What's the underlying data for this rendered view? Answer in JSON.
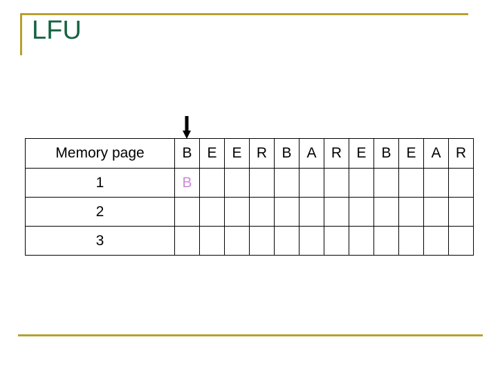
{
  "slide": {
    "title": "LFU",
    "title_color": "#156341",
    "accent_rule_color": "#b8a02e"
  },
  "arrow": {
    "icon": "arrow-down-icon",
    "points_to_column_index": 0
  },
  "table": {
    "label_header": "Memory page",
    "reference_string": [
      "B",
      "E",
      "E",
      "R",
      "B",
      "A",
      "R",
      "E",
      "B",
      "E",
      "A",
      "R"
    ],
    "rows": [
      {
        "index": "1",
        "cells": [
          "B",
          "",
          "",
          "",
          "",
          "",
          "",
          "",
          "",
          "",
          "",
          ""
        ],
        "accent_color": "#cc88dd"
      },
      {
        "index": "2",
        "cells": [
          "",
          "",
          "",
          "",
          "",
          "",
          "",
          "",
          "",
          "",
          "",
          ""
        ],
        "accent_color": "#cc88dd"
      },
      {
        "index": "3",
        "cells": [
          "",
          "",
          "",
          "",
          "",
          "",
          "",
          "",
          "",
          "",
          "",
          ""
        ],
        "accent_color": "#cc88dd"
      }
    ]
  }
}
